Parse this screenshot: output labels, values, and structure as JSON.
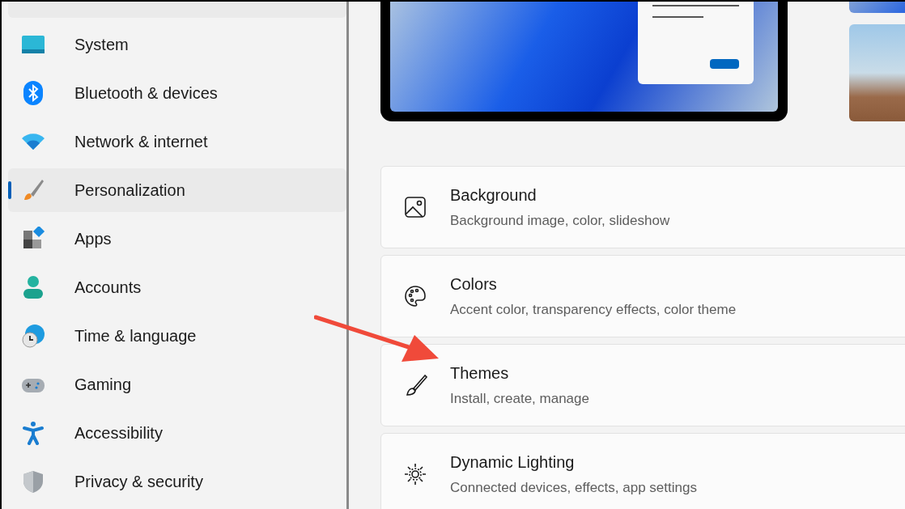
{
  "sidebar": {
    "items": [
      {
        "label": "System",
        "selected": false
      },
      {
        "label": "Bluetooth & devices",
        "selected": false
      },
      {
        "label": "Network & internet",
        "selected": false
      },
      {
        "label": "Personalization",
        "selected": true
      },
      {
        "label": "Apps",
        "selected": false
      },
      {
        "label": "Accounts",
        "selected": false
      },
      {
        "label": "Time & language",
        "selected": false
      },
      {
        "label": "Gaming",
        "selected": false
      },
      {
        "label": "Accessibility",
        "selected": false
      },
      {
        "label": "Privacy & security",
        "selected": false
      }
    ]
  },
  "settings": [
    {
      "title": "Background",
      "description": "Background image, color, slideshow"
    },
    {
      "title": "Colors",
      "description": "Accent color, transparency effects, color theme"
    },
    {
      "title": "Themes",
      "description": "Install, create, manage"
    },
    {
      "title": "Dynamic Lighting",
      "description": "Connected devices, effects, app settings"
    }
  ]
}
